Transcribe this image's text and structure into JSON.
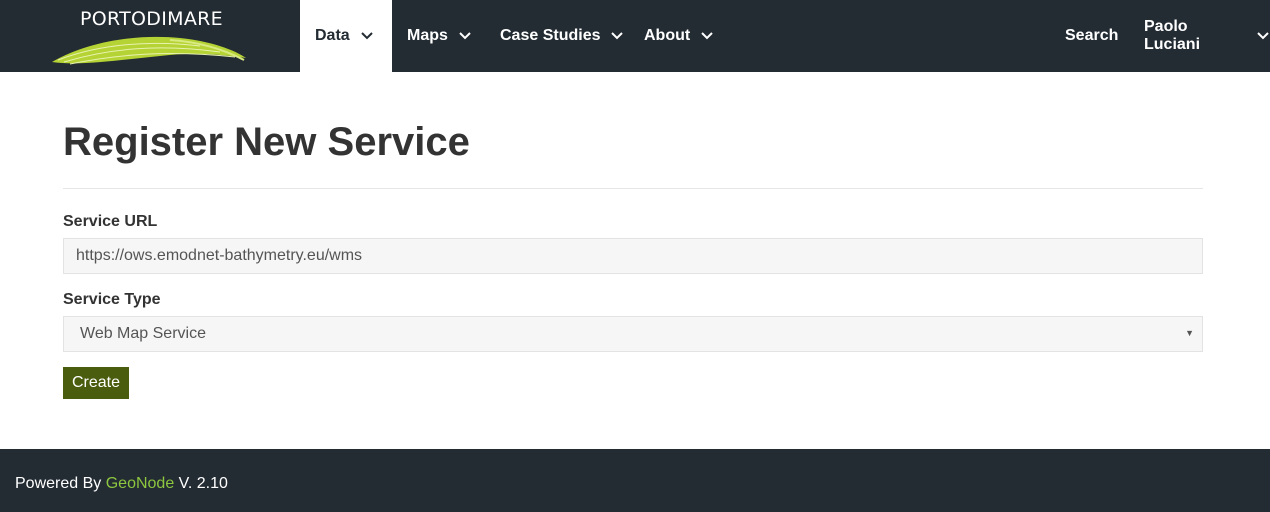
{
  "brand": {
    "name": "PORTODIMARE",
    "logo_color": "#b5d334"
  },
  "nav": {
    "items": [
      {
        "label": "Data",
        "active": true
      },
      {
        "label": "Maps"
      },
      {
        "label": "Case Studies"
      },
      {
        "label": "About"
      }
    ],
    "search_label": "Search",
    "user_label": "Paolo Luciani"
  },
  "page": {
    "title": "Register New Service"
  },
  "form": {
    "url_label": "Service URL",
    "url_value": "https://ows.emodnet-bathymetry.eu/wms",
    "type_label": "Service Type",
    "type_value": "Web Map Service",
    "submit_label": "Create"
  },
  "footer": {
    "prefix": "Powered By ",
    "link_text": "GeoNode",
    "suffix": " V. 2.10"
  },
  "colors": {
    "navbar_bg": "#232b33",
    "button_bg": "#4a5c0d",
    "footer_link": "#8dc63f"
  }
}
